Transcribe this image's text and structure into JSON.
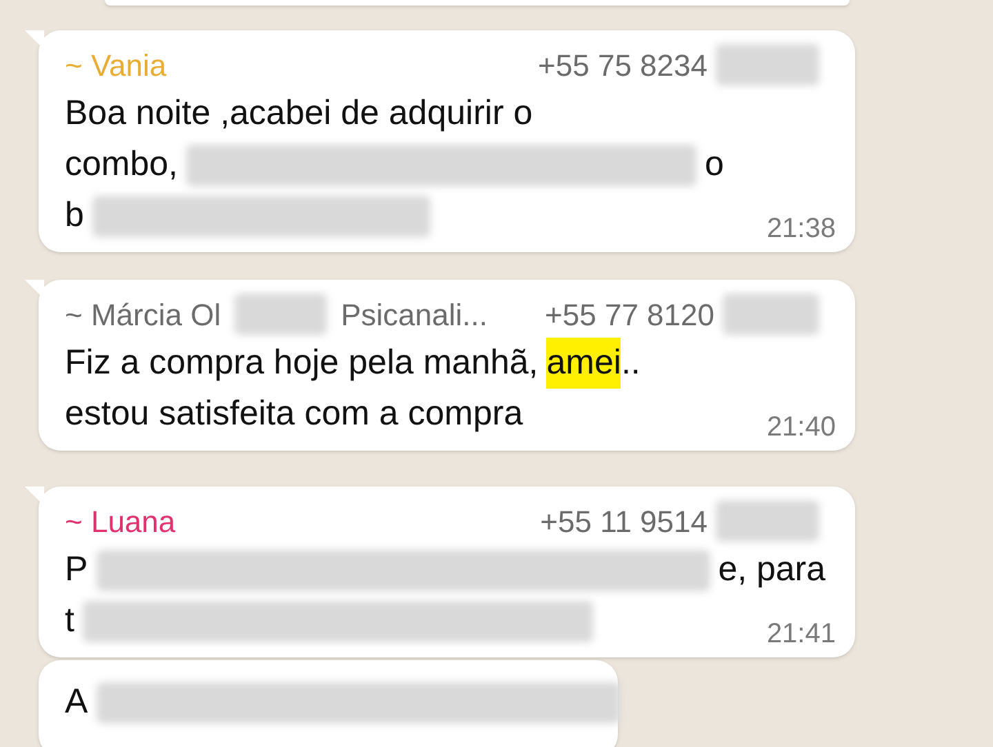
{
  "messages": [
    {
      "sender": {
        "name": [
          {
            "kind": "text",
            "text": "~ Vania"
          }
        ],
        "color": "#e7ad34",
        "phone": [
          {
            "kind": "text",
            "text": "+55 75 8234"
          },
          {
            "kind": "redacted"
          }
        ]
      },
      "lines": [
        [
          {
            "kind": "text",
            "text": "Boa noite ,acabei de adquirir o"
          }
        ],
        [
          {
            "kind": "text",
            "text": "combo,"
          },
          {
            "kind": "redacted"
          },
          {
            "kind": "text",
            "text": "o"
          }
        ],
        [
          {
            "kind": "text",
            "text": "b"
          },
          {
            "kind": "redacted"
          }
        ]
      ],
      "time": "21:38"
    },
    {
      "sender": {
        "name": [
          {
            "kind": "text",
            "text": "~ Márcia Ol"
          },
          {
            "kind": "redacted"
          },
          {
            "kind": "text",
            "text": "Psicanali..."
          }
        ],
        "color": "#6b6b6b",
        "phone": [
          {
            "kind": "text",
            "text": "+55 77 8120"
          },
          {
            "kind": "redacted"
          }
        ]
      },
      "lines": [
        [
          {
            "kind": "text",
            "text": "Fiz a compra hoje pela manhã,"
          },
          {
            "kind": "highlight",
            "text": "amei"
          },
          {
            "kind": "text",
            "text": ".."
          }
        ],
        [
          {
            "kind": "text",
            "text": "estou satisfeita com a compra"
          }
        ]
      ],
      "time": "21:40"
    },
    {
      "sender": {
        "name": [
          {
            "kind": "text",
            "text": "~ Luana"
          }
        ],
        "color": "#e0326e",
        "phone": [
          {
            "kind": "text",
            "text": "+55 11 9514"
          },
          {
            "kind": "redacted"
          }
        ]
      },
      "lines": [
        [
          {
            "kind": "text",
            "text": "P"
          },
          {
            "kind": "redacted"
          },
          {
            "kind": "text",
            "text": "e, para"
          }
        ],
        [
          {
            "kind": "text",
            "text": "t"
          },
          {
            "kind": "redacted"
          }
        ]
      ],
      "time": "21:41"
    },
    {
      "lines": [
        [
          {
            "kind": "text",
            "text": "A"
          },
          {
            "kind": "redacted"
          }
        ]
      ]
    }
  ]
}
